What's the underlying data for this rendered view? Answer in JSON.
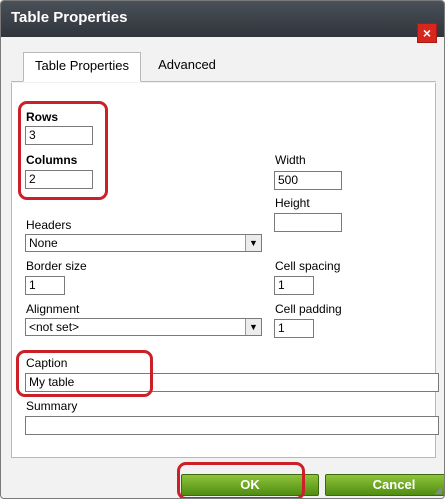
{
  "dialog": {
    "title": "Table Properties",
    "close_label": "×"
  },
  "tabs": [
    {
      "label": "Table Properties",
      "active": true
    },
    {
      "label": "Advanced",
      "active": false
    }
  ],
  "fields": {
    "rows": {
      "label": "Rows",
      "value": "3"
    },
    "columns": {
      "label": "Columns",
      "value": "2"
    },
    "width": {
      "label": "Width",
      "value": "500"
    },
    "height": {
      "label": "Height",
      "value": ""
    },
    "headers": {
      "label": "Headers",
      "value": "None"
    },
    "border_size": {
      "label": "Border size",
      "value": "1"
    },
    "cell_spacing": {
      "label": "Cell spacing",
      "value": "1"
    },
    "alignment": {
      "label": "Alignment",
      "value": "<not set>"
    },
    "cell_padding": {
      "label": "Cell padding",
      "value": "1"
    },
    "caption": {
      "label": "Caption",
      "value": "My table"
    },
    "summary": {
      "label": "Summary",
      "value": ""
    }
  },
  "buttons": {
    "ok": "OK",
    "cancel": "Cancel"
  },
  "icons": {
    "dropdown_arrow": "▼",
    "resize_grip": "◢"
  },
  "colors": {
    "titlebar": "#3a4048",
    "close": "#d9261c",
    "highlight": "#cc1f28",
    "button_green": "#6aa625"
  }
}
